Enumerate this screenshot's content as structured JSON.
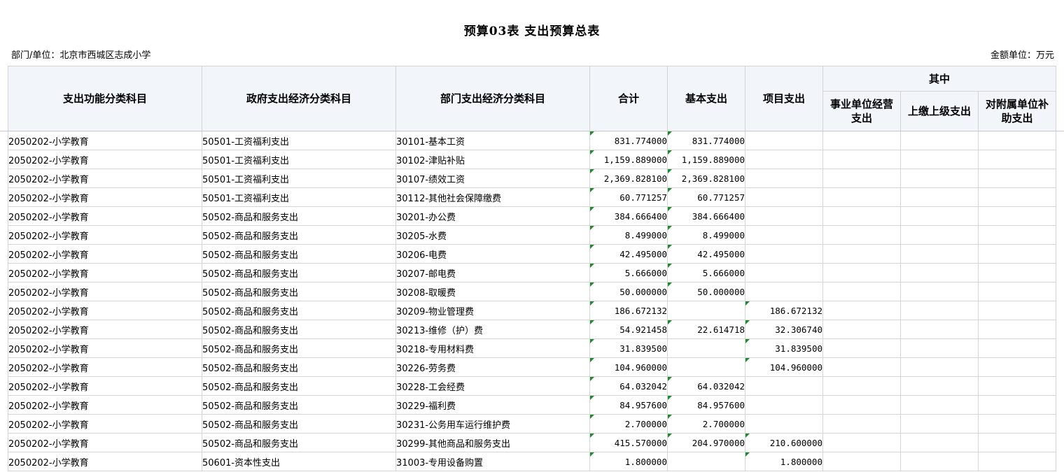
{
  "title": "预算03表  支出预算总表",
  "dept_label": "部门/单位：北京市西城区志成小学",
  "unit_label": "金额单位：万元",
  "headers": {
    "func": "支出功能分类科目",
    "gov": "政府支出经济分类科目",
    "dept": "部门支出经济分类科目",
    "total": "合计",
    "basic": "基本支出",
    "project": "项目支出",
    "among": "其中",
    "biz": "事业单位经营支出",
    "upper": "上缴上级支出",
    "subsidy": "对附属单位补助支出"
  },
  "rows": [
    {
      "func": "2050202-小学教育",
      "gov": "50501-工资福利支出",
      "dept": "30101-基本工资",
      "total": "831.774000",
      "basic": "831.774000",
      "project": "",
      "biz": "",
      "upper": "",
      "subsidy": ""
    },
    {
      "func": "2050202-小学教育",
      "gov": "50501-工资福利支出",
      "dept": "30102-津贴补贴",
      "total": "1,159.889000",
      "basic": "1,159.889000",
      "project": "",
      "biz": "",
      "upper": "",
      "subsidy": ""
    },
    {
      "func": "2050202-小学教育",
      "gov": "50501-工资福利支出",
      "dept": "30107-绩效工资",
      "total": "2,369.828100",
      "basic": "2,369.828100",
      "project": "",
      "biz": "",
      "upper": "",
      "subsidy": ""
    },
    {
      "func": "2050202-小学教育",
      "gov": "50501-工资福利支出",
      "dept": "30112-其他社会保障缴费",
      "total": "60.771257",
      "basic": "60.771257",
      "project": "",
      "biz": "",
      "upper": "",
      "subsidy": ""
    },
    {
      "func": "2050202-小学教育",
      "gov": "50502-商品和服务支出",
      "dept": "30201-办公费",
      "total": "384.666400",
      "basic": "384.666400",
      "project": "",
      "biz": "",
      "upper": "",
      "subsidy": ""
    },
    {
      "func": "2050202-小学教育",
      "gov": "50502-商品和服务支出",
      "dept": "30205-水费",
      "total": "8.499000",
      "basic": "8.499000",
      "project": "",
      "biz": "",
      "upper": "",
      "subsidy": ""
    },
    {
      "func": "2050202-小学教育",
      "gov": "50502-商品和服务支出",
      "dept": "30206-电费",
      "total": "42.495000",
      "basic": "42.495000",
      "project": "",
      "biz": "",
      "upper": "",
      "subsidy": ""
    },
    {
      "func": "2050202-小学教育",
      "gov": "50502-商品和服务支出",
      "dept": "30207-邮电费",
      "total": "5.666000",
      "basic": "5.666000",
      "project": "",
      "biz": "",
      "upper": "",
      "subsidy": ""
    },
    {
      "func": "2050202-小学教育",
      "gov": "50502-商品和服务支出",
      "dept": "30208-取暖费",
      "total": "50.000000",
      "basic": "50.000000",
      "project": "",
      "biz": "",
      "upper": "",
      "subsidy": ""
    },
    {
      "func": "2050202-小学教育",
      "gov": "50502-商品和服务支出",
      "dept": "30209-物业管理费",
      "total": "186.672132",
      "basic": "",
      "project": "186.672132",
      "biz": "",
      "upper": "",
      "subsidy": ""
    },
    {
      "func": "2050202-小学教育",
      "gov": "50502-商品和服务支出",
      "dept": "30213-维修（护）费",
      "total": "54.921458",
      "basic": "22.614718",
      "project": "32.306740",
      "biz": "",
      "upper": "",
      "subsidy": ""
    },
    {
      "func": "2050202-小学教育",
      "gov": "50502-商品和服务支出",
      "dept": "30218-专用材料费",
      "total": "31.839500",
      "basic": "",
      "project": "31.839500",
      "biz": "",
      "upper": "",
      "subsidy": ""
    },
    {
      "func": "2050202-小学教育",
      "gov": "50502-商品和服务支出",
      "dept": "30226-劳务费",
      "total": "104.960000",
      "basic": "",
      "project": "104.960000",
      "biz": "",
      "upper": "",
      "subsidy": ""
    },
    {
      "func": "2050202-小学教育",
      "gov": "50502-商品和服务支出",
      "dept": "30228-工会经费",
      "total": "64.032042",
      "basic": "64.032042",
      "project": "",
      "biz": "",
      "upper": "",
      "subsidy": ""
    },
    {
      "func": "2050202-小学教育",
      "gov": "50502-商品和服务支出",
      "dept": "30229-福利费",
      "total": "84.957600",
      "basic": "84.957600",
      "project": "",
      "biz": "",
      "upper": "",
      "subsidy": ""
    },
    {
      "func": "2050202-小学教育",
      "gov": "50502-商品和服务支出",
      "dept": "30231-公务用车运行维护费",
      "total": "2.700000",
      "basic": "2.700000",
      "project": "",
      "biz": "",
      "upper": "",
      "subsidy": ""
    },
    {
      "func": "2050202-小学教育",
      "gov": "50502-商品和服务支出",
      "dept": "30299-其他商品和服务支出",
      "total": "415.570000",
      "basic": "204.970000",
      "project": "210.600000",
      "biz": "",
      "upper": "",
      "subsidy": ""
    },
    {
      "func": "2050202-小学教育",
      "gov": "50601-资本性支出",
      "dept": "31003-专用设备购置",
      "total": "1.800000",
      "basic": "",
      "project": "1.800000",
      "biz": "",
      "upper": "",
      "subsidy": ""
    }
  ]
}
